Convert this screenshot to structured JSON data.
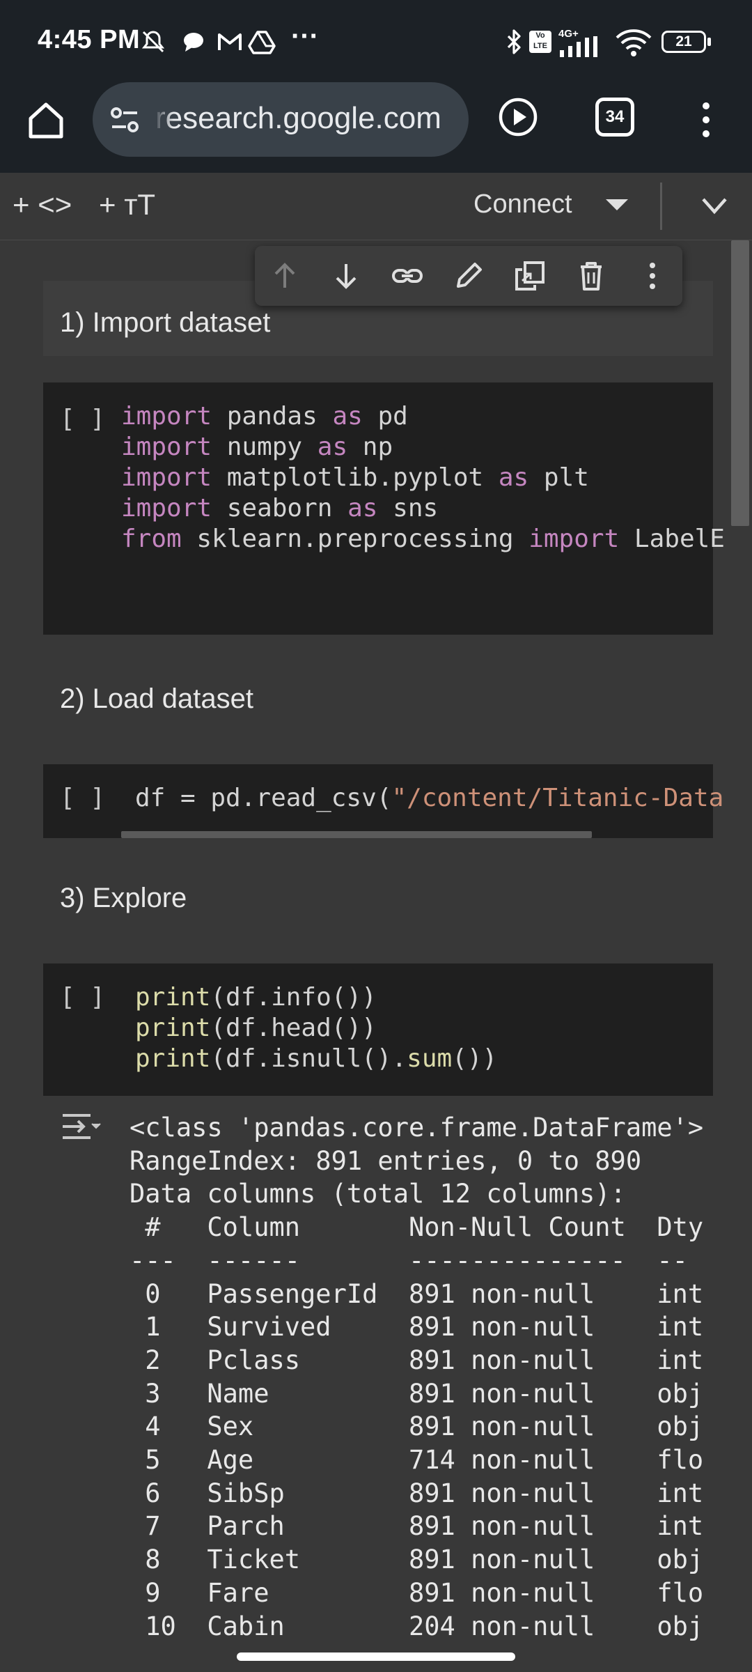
{
  "status_bar": {
    "time": "4:45 PM",
    "more": "···",
    "battery": "21",
    "network": "4G+",
    "volte": "Vo LTE"
  },
  "browser": {
    "url": "research.google.com",
    "tab_count": "34"
  },
  "colab_toolbar": {
    "add_code": "+ <>",
    "add_text": "+ тT",
    "connect": "Connect"
  },
  "cells": {
    "h1": "1) Import dataset",
    "h2": "2) Load dataset",
    "h3": "3) Explore",
    "run_bracket": "[ ]",
    "code1": [
      {
        "kw": "import",
        "rest": " pandas ",
        "kw2": "as",
        "rest2": " pd"
      },
      {
        "kw": "import",
        "rest": " numpy ",
        "kw2": "as",
        "rest2": " np"
      },
      {
        "kw": "import",
        "rest": " matplotlib.pyplot ",
        "kw2": "as",
        "rest2": " plt"
      },
      {
        "kw": "import",
        "rest": " seaborn ",
        "kw2": "as",
        "rest2": " sns"
      },
      {
        "kw": "from",
        "rest": " sklearn.preprocessing ",
        "kw2": "import",
        "rest2": " LabelE"
      }
    ],
    "code2": {
      "prefix": "df = pd.read_csv(",
      "str": "\"/content/Titanic-Data"
    },
    "code3": [
      {
        "fn": "print",
        "mid": "(df.info())"
      },
      {
        "fn": "print",
        "mid": "(df.head())"
      },
      {
        "fn": "print",
        "mid": "(df.isnull().",
        "fn2": "sum",
        "tail": "())"
      }
    ]
  },
  "output_lines": [
    "<class 'pandas.core.frame.DataFrame'>",
    "RangeIndex: 891 entries, 0 to 890",
    "Data columns (total 12 columns):",
    " #   Column       Non-Null Count  Dty",
    "---  ------       --------------  --",
    " 0   PassengerId  891 non-null    int",
    " 1   Survived     891 non-null    int",
    " 2   Pclass       891 non-null    int",
    " 3   Name         891 non-null    obj",
    " 4   Sex          891 non-null    obj",
    " 5   Age          714 non-null    flo",
    " 6   SibSp        891 non-null    int",
    " 7   Parch        891 non-null    int",
    " 8   Ticket       891 non-null    obj",
    " 9   Fare         891 non-null    flo",
    " 10  Cabin        204 non-null    obj"
  ],
  "colors": {
    "chrome_bg": "#1c2126",
    "notebook_bg": "#383838",
    "code_bg": "#1f1f1f",
    "keyword": "#c586c0",
    "function": "#dcdcaa",
    "string": "#ce9178"
  }
}
